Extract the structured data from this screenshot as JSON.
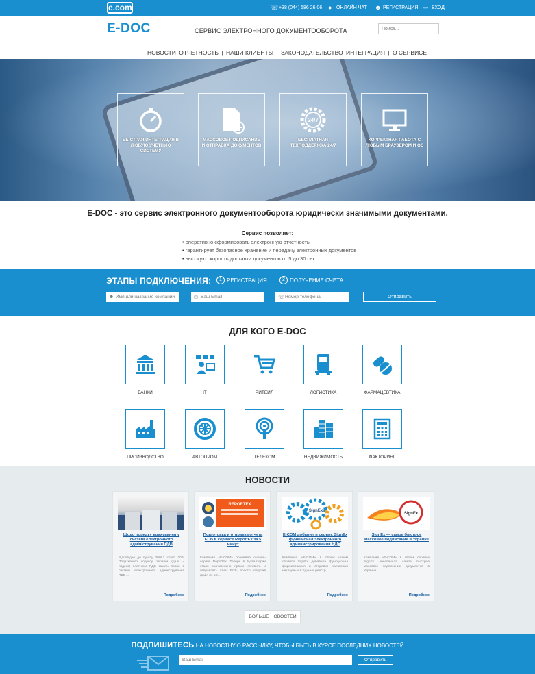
{
  "topbar": {
    "logo": "e.com",
    "phone": "+38 (044) 586 26 06",
    "chat": "ОНЛАЙН ЧАТ",
    "register": "РЕГИСТРАЦИЯ",
    "login": "ВХОД"
  },
  "header": {
    "brand": "E-DOC",
    "tagline": "СЕРВИС ЭЛЕКТРОННОГО ДОКУМЕНТООБОРОТА",
    "search_placeholder": "Поиск..."
  },
  "nav": {
    "items": [
      "НОВОСТИ",
      "ОТЧЕТНОСТЬ",
      "НАШИ КЛИЕНТЫ",
      "ЗАКОНОДАТЕЛЬСТВО",
      "ИНТЕГРАЦИЯ",
      "О СЕРВИСЕ"
    ]
  },
  "hero": {
    "features": [
      {
        "icon": "stopwatch-icon",
        "label": "БЫСТРАЯ ИНТЕГРАЦИЯ В ЛЮБУЮ УЧЕТНУЮ СИСТЕМУ"
      },
      {
        "icon": "document-add-icon",
        "label": "МАССОВОЕ ПОДПИСАНИЕ И ОТПРАВКА ДОКУМЕНТОВ"
      },
      {
        "icon": "gear-24-7-icon",
        "label": "БЕСПЛАТНАЯ ТЕХПОДДЕРЖКА 24/7",
        "badge": "24/7"
      },
      {
        "icon": "monitor-icon",
        "label": "КОРРЕКТНАЯ РАБОТА С ЛЮБЫМ БРАУЗЕРОМ И ОС"
      }
    ]
  },
  "intro": {
    "headline": "E-DOC - это сервис электронного документооборота юридически значимыми документами.",
    "allows_title": "Сервис позволяет:",
    "bullets": [
      "оперативно сформировать электронную отчетность",
      "гарантирует безопасное хранение и передачу электронных документов",
      "высокую скорость доставки документов от 5 до 30 сек."
    ]
  },
  "connect": {
    "title": "ЭТАПЫ ПОДКЛЮЧЕНИЯ:",
    "steps": [
      {
        "num": "1",
        "label": "РЕГИСТРАЦИЯ"
      },
      {
        "num": "2",
        "label": "ПОЛУЧЕНИЕ СЧЕТА"
      }
    ],
    "name_placeholder": "Имя или название компании",
    "email_placeholder": "Ваш Email",
    "phone_placeholder": "Номер телефона",
    "submit": "Отправить"
  },
  "for_whom": {
    "title": "ДЛЯ КОГО E-DOC",
    "industries": [
      {
        "icon": "bank-icon",
        "label": "БАНКИ"
      },
      {
        "icon": "it-icon",
        "label": "IT"
      },
      {
        "icon": "cart-icon",
        "label": "РИТЕЙЛ"
      },
      {
        "icon": "truck-icon",
        "label": "ЛОГИСТИКА"
      },
      {
        "icon": "pills-icon",
        "label": "ФАРМАЦЕВТИКА"
      },
      {
        "icon": "factory-icon",
        "label": "ПРОИЗВОДСТВО"
      },
      {
        "icon": "wheel-icon",
        "label": "АВТОПРОМ"
      },
      {
        "icon": "antenna-icon",
        "label": "ТЕЛЕКОМ"
      },
      {
        "icon": "buildings-icon",
        "label": "НЕДВИЖИМОСТЬ"
      },
      {
        "icon": "calculator-icon",
        "label": "ФАКТОРИНГ"
      }
    ]
  },
  "news": {
    "title": "НОВОСТИ",
    "cards": [
      {
        "title": "Щодо порядку врахування у системі електронного адміністрування ПДВ",
        "text": "Відповідно до пункту 200¹.3 статті 200¹ Податкового кодексу України (далі – Кодекс) платники ПДВ мають право в системі електронного адміністрування ПДВ ...",
        "more": "Подробнее"
      },
      {
        "title": "Подготовка и отправка отчета ЕСВ в сервисе ReportEx за 5 минут",
        "text": "Компания «E-COM» обновила онлайн-сервис ReportEx. Теперь в бухгалтерии стало значительно проще готовить и отправлять отчет ЕСВ, просто загрузив файл из 1С...",
        "more": "Подробнее",
        "banner": "REPORTEX"
      },
      {
        "title": "E-COM добавил в сервис SignEx функционал электронного администрирования НДС",
        "text": "Компания «E-COM» в своем новом сервисе SignEx добавила функционал формирования и отправки налоговых накладных в Единый реестр ...",
        "more": "Подробнее",
        "badge": "SignEx"
      },
      {
        "title": "SignEx — самое быстрое массовое подписание в Украине",
        "text": "Компания «E-COM» в своем сервисе SignEx обеспечила самое быстрое массовое подписание документов в Украине ...",
        "more": "Подробнее",
        "badge": "SignEx"
      }
    ],
    "more_button": "БОЛЬШЕ НОВОСТЕЙ"
  },
  "subscribe": {
    "bold": "ПОДПИШИТЕСЬ",
    "text": "НА НОВОСТНУЮ РАССЫЛКУ, ЧТОБЫ БЫТЬ В КУРСЕ ПОСЛЕДНИХ НОВОСТЕЙ",
    "email_placeholder": "Ваш Email",
    "submit": "Отправить"
  }
}
